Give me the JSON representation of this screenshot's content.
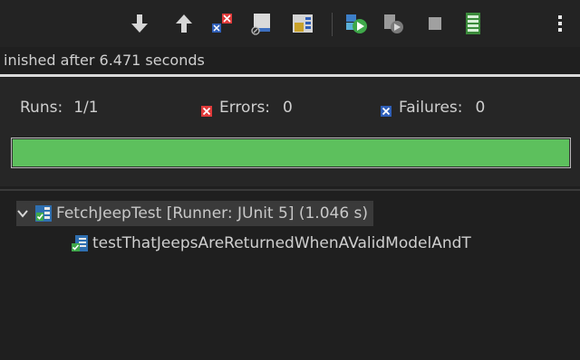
{
  "toolbar": {
    "buttons": [
      {
        "name": "next-failure-button",
        "icon": "arrow-down-icon"
      },
      {
        "name": "previous-failure-button",
        "icon": "arrow-up-icon"
      },
      {
        "name": "show-failures-only-button",
        "icon": "failures-only-icon"
      },
      {
        "name": "scroll-lock-button",
        "icon": "scroll-lock-icon"
      },
      {
        "name": "show-skipped-button",
        "icon": "skipped-tests-icon"
      },
      {
        "name": "rerun-test-button",
        "icon": "rerun-icon"
      },
      {
        "name": "rerun-failures-first-button",
        "icon": "rerun-failures-first-icon"
      },
      {
        "name": "stop-button",
        "icon": "stop-icon"
      },
      {
        "name": "test-run-history-button",
        "icon": "history-icon"
      },
      {
        "name": "view-menu-button",
        "icon": "kebab-menu-icon"
      }
    ]
  },
  "status": {
    "message": "inished after 6.471 seconds"
  },
  "counters": {
    "runs_label": "Runs:",
    "runs_value": "1/1",
    "errors_label": "Errors:",
    "errors_value": "0",
    "failures_label": "Failures:",
    "failures_value": "0"
  },
  "progress": {
    "fraction": 1.0,
    "color": "#5dc05d"
  },
  "tree": {
    "suite": {
      "label": "FetchJeepTest [Runner: JUnit 5] (1.046 s)",
      "icon": "test-suite-passed-icon",
      "expanded": true
    },
    "tests": [
      {
        "label": "testThatJeepsAreReturnedWhenAValidModelAndT",
        "icon": "test-passed-icon"
      }
    ]
  },
  "colors": {
    "background": "#1f1f1f",
    "error_red": "#e03a3a",
    "failure_blue": "#2f5fb8",
    "pass_green": "#5dc05d"
  }
}
